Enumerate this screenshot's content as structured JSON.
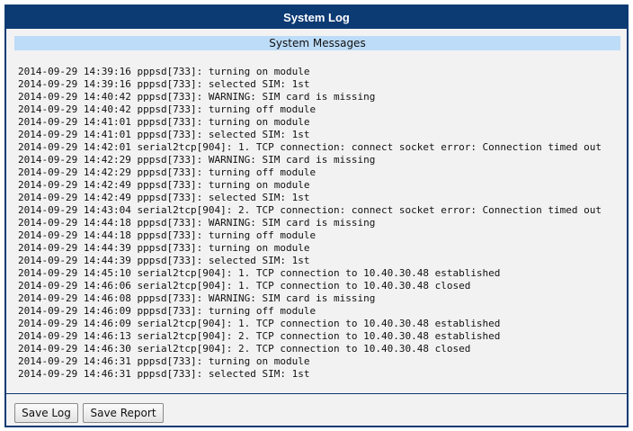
{
  "window": {
    "title": "System Log"
  },
  "section": {
    "title": "System Messages"
  },
  "log": {
    "lines": [
      "2014-09-29 14:39:16 pppsd[733]: turning on module",
      "2014-09-29 14:39:16 pppsd[733]: selected SIM: 1st",
      "2014-09-29 14:40:42 pppsd[733]: WARNING: SIM card is missing",
      "2014-09-29 14:40:42 pppsd[733]: turning off module",
      "2014-09-29 14:41:01 pppsd[733]: turning on module",
      "2014-09-29 14:41:01 pppsd[733]: selected SIM: 1st",
      "2014-09-29 14:42:01 serial2tcp[904]: 1. TCP connection: connect socket error: Connection timed out",
      "2014-09-29 14:42:29 pppsd[733]: WARNING: SIM card is missing",
      "2014-09-29 14:42:29 pppsd[733]: turning off module",
      "2014-09-29 14:42:49 pppsd[733]: turning on module",
      "2014-09-29 14:42:49 pppsd[733]: selected SIM: 1st",
      "2014-09-29 14:43:04 serial2tcp[904]: 2. TCP connection: connect socket error: Connection timed out",
      "2014-09-29 14:44:18 pppsd[733]: WARNING: SIM card is missing",
      "2014-09-29 14:44:18 pppsd[733]: turning off module",
      "2014-09-29 14:44:39 pppsd[733]: turning on module",
      "2014-09-29 14:44:39 pppsd[733]: selected SIM: 1st",
      "2014-09-29 14:45:10 serial2tcp[904]: 1. TCP connection to 10.40.30.48 established",
      "2014-09-29 14:46:06 serial2tcp[904]: 1. TCP connection to 10.40.30.48 closed",
      "2014-09-29 14:46:08 pppsd[733]: WARNING: SIM card is missing",
      "2014-09-29 14:46:09 pppsd[733]: turning off module",
      "2014-09-29 14:46:09 serial2tcp[904]: 1. TCP connection to 10.40.30.48 established",
      "2014-09-29 14:46:13 serial2tcp[904]: 2. TCP connection to 10.40.30.48 established",
      "2014-09-29 14:46:30 serial2tcp[904]: 2. TCP connection to 10.40.30.48 closed",
      "2014-09-29 14:46:31 pppsd[733]: turning on module",
      "2014-09-29 14:46:31 pppsd[733]: selected SIM: 1st"
    ]
  },
  "buttons": {
    "save_log": "Save Log",
    "save_report": "Save Report"
  },
  "colors": {
    "title_bar": "#0c3a73",
    "section_header": "#bcdcf8",
    "panel_background": "#f2f2f2"
  }
}
